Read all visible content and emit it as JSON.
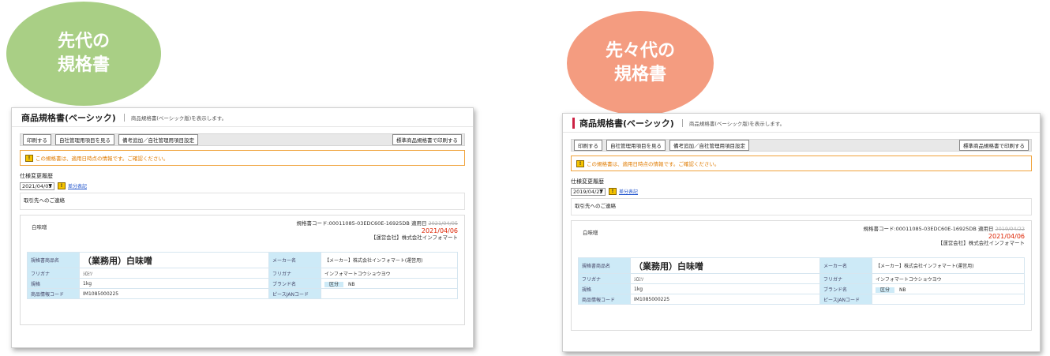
{
  "bubbles": {
    "left": {
      "line1": "先代の",
      "line2": "規格書",
      "color": "#a9cf85"
    },
    "right": {
      "line1": "先々代の",
      "line2": "規格書",
      "color": "#f49c80"
    }
  },
  "common": {
    "page_title": "商品規格書(ベーシック)",
    "page_desc": "商品規格書(ベーシック版)を表示します。",
    "toolbar": {
      "print": "印刷する",
      "view_own_items": "自社管理用項目を見る",
      "add_notes": "備考追加／自社管理用項目設定",
      "print_standard": "標準商品規格書で印刷する"
    },
    "notice_text": "この規格書は、適用日時点の情報です。ご確認ください。",
    "history_label": "仕様変更履歴",
    "diff_link": "差分表記",
    "contact_label": "取引先へのご連絡",
    "product_kind": "白味噌",
    "product_code": "規格書コード:00011085-03EDC60E-16925DB",
    "apply_label": "適用日",
    "apply_date": "2021/04/06",
    "company": "【運営会社】株式会社インフォマート",
    "spec": {
      "name_label": "規格書商品名",
      "name_value": "（業務用）白味噌",
      "maker_label": "メーカー名",
      "maker_value": "【メーカー】株式会社インフォマート(運営用)",
      "furigana_label": "フリガナ",
      "furigana_value": "ｼﾛﾐｿ",
      "maker_furigana_label": "フリガナ",
      "maker_furigana_value": "インフォマートコウショウヨウ",
      "spec_label": "規格",
      "spec_value": "1kg",
      "brand_label": "ブランド名",
      "kubun_label": "区分",
      "kubun_value": "NB",
      "info_code_label": "商品情報コード",
      "info_code_value": "IM1085000225",
      "piece_jan_label": "ピースJANコード"
    }
  },
  "left_shot": {
    "selected_date": "2021/04/05",
    "old_apply_date": "2021/04/05"
  },
  "right_shot": {
    "selected_date": "2019/04/22",
    "old_apply_date": "2019/04/22"
  },
  "colors": {
    "notice_border": "#f0a33c",
    "label_bg": "#cdeaf7",
    "title_accent": "#cc2244"
  }
}
